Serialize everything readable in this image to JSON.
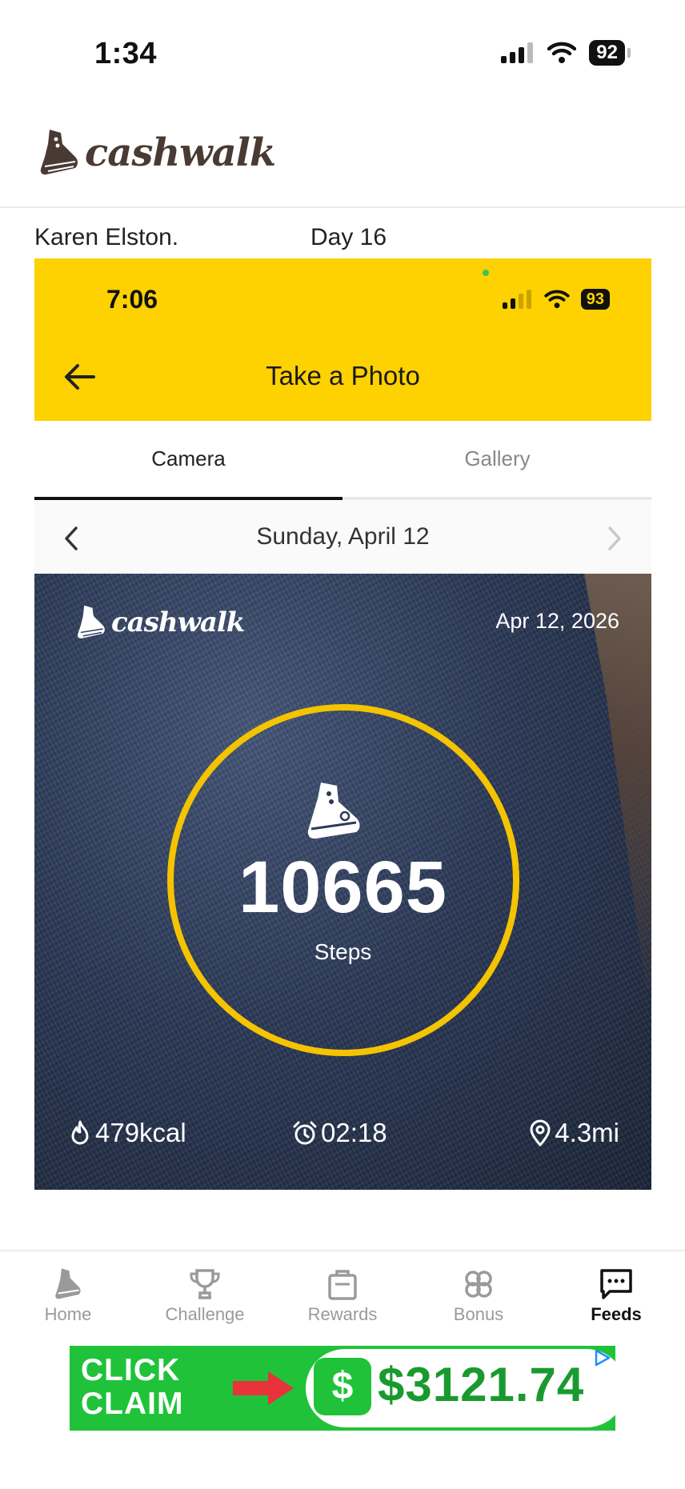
{
  "status_bar": {
    "time": "1:34",
    "battery": "92"
  },
  "app": {
    "logo_text": "cashwalk"
  },
  "post": {
    "author": "Karen Elston.",
    "day": "Day 16"
  },
  "embedded": {
    "status_time": "7:06",
    "status_battery": "93",
    "title": "Take a Photo",
    "tabs": [
      {
        "label": "Camera",
        "active": true
      },
      {
        "label": "Gallery",
        "active": false
      }
    ],
    "date_label": "Sunday, April 12",
    "photo": {
      "logo_text": "cashwalk",
      "date": "Apr 12, 2026",
      "steps": "10665",
      "steps_label": "Steps",
      "calories": "479kcal",
      "duration": "02:18",
      "distance": "4.3mi",
      "ring_color": "#f5c400"
    },
    "header_color": "#fed100"
  },
  "tabbar": {
    "items": [
      {
        "label": "Home",
        "icon": "shoe-icon",
        "active": false
      },
      {
        "label": "Challenge",
        "icon": "trophy-icon",
        "active": false
      },
      {
        "label": "Rewards",
        "icon": "shopping-bag-icon",
        "active": false
      },
      {
        "label": "Bonus",
        "icon": "clover-icon",
        "active": false
      },
      {
        "label": "Feeds",
        "icon": "chat-bubble-icon",
        "active": true
      }
    ]
  },
  "ad": {
    "cta_line1": "CLICK",
    "cta_line2": "CLAIM",
    "dollar_symbol": "$",
    "amount": "$3121.74",
    "color": "#20c23a"
  }
}
